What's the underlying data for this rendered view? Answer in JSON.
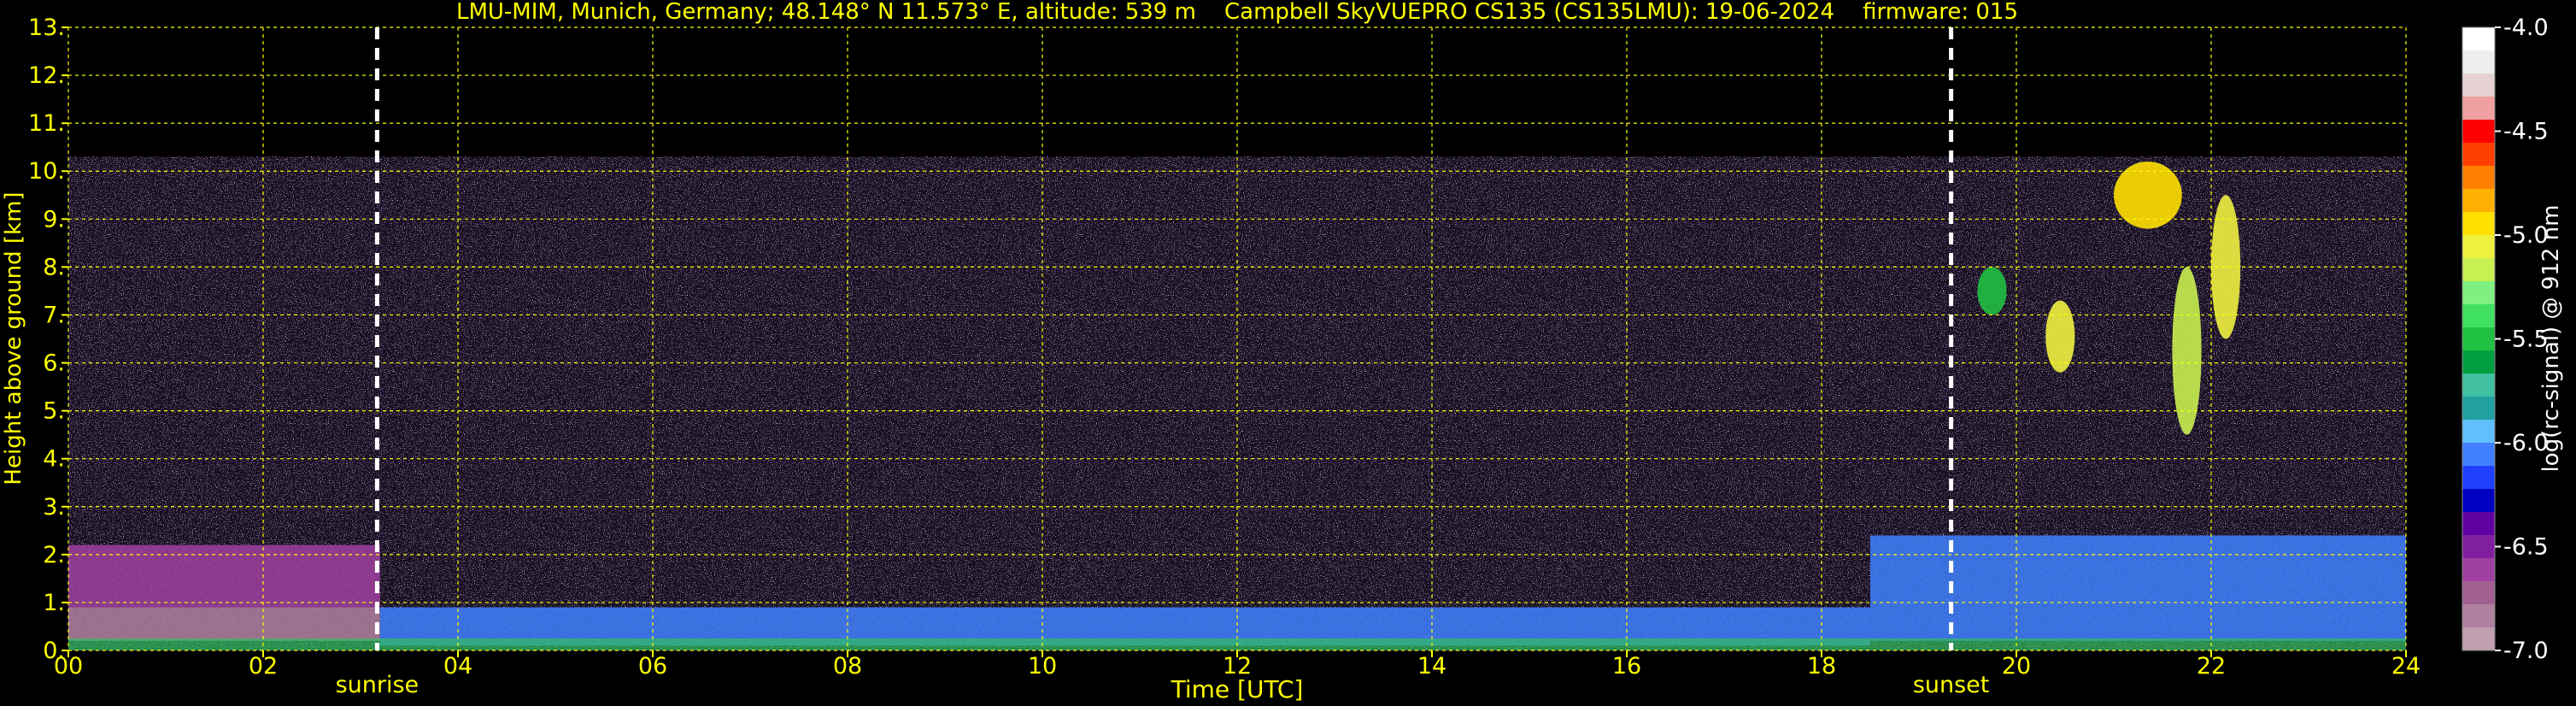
{
  "chart_data": {
    "type": "heatmap",
    "title": "LMU-MIM, Munich, Germany; 48.148° N 11.573° E, altitude: 539 m    Campbell SkyVUEPRO CS135 (CS135LMU): 19-06-2024    firmware: 015",
    "xlabel": "Time [UTC]",
    "ylabel": "Height above ground [km]",
    "xlim": [
      0,
      24
    ],
    "ylim": [
      0,
      13
    ],
    "xticks": [
      0,
      2,
      4,
      6,
      8,
      10,
      12,
      14,
      16,
      18,
      20,
      22,
      24
    ],
    "xtick_labels": [
      "00",
      "02",
      "04",
      "06",
      "08",
      "10",
      "12",
      "14",
      "16",
      "18",
      "20",
      "22",
      "24"
    ],
    "yticks": [
      0,
      1,
      2,
      3,
      4,
      5,
      6,
      7,
      8,
      9,
      10,
      11,
      12,
      13
    ],
    "ytick_labels": [
      "0.",
      "1.",
      "2.",
      "3.",
      "4.",
      "5.",
      "6.",
      "7.",
      "8.",
      "9.",
      "10.",
      "11.",
      "12.",
      "13."
    ],
    "grid": true,
    "colorbar": {
      "label": "log(rc-signal) @ 912 nm",
      "range": [
        -7.0,
        -4.0
      ],
      "ticks": [
        -4.0,
        -4.5,
        -5.0,
        -5.5,
        -6.0,
        -6.5,
        -7.0
      ],
      "tick_labels": [
        "-4.0",
        "-4.5",
        "-5.0",
        "-5.5",
        "-6.0",
        "-6.5",
        "-7.0"
      ],
      "colors": [
        "#ffffff",
        "#eeeeee",
        "#e6d2d2",
        "#f0a0a0",
        "#ff0000",
        "#ff4000",
        "#ff8000",
        "#ffb000",
        "#ffe000",
        "#f0f040",
        "#c8f050",
        "#80f080",
        "#40e060",
        "#20c040",
        "#00a040",
        "#40c0a0",
        "#20a0a0",
        "#60c0ff",
        "#4080ff",
        "#2040ff",
        "#0000c0",
        "#6000a0",
        "#8020a0",
        "#a040a0",
        "#a06090",
        "#b080a0",
        "#c0a0b0"
      ]
    },
    "markers": [
      {
        "label": "sunrise",
        "x": 3.17
      },
      {
        "label": "sunset",
        "x": 19.33
      }
    ],
    "data_top_km": 10.3,
    "features": [
      {
        "name": "noise-layer",
        "x": [
          0,
          24
        ],
        "y": [
          0,
          10.3
        ],
        "value": -6.5
      },
      {
        "name": "residual-layer",
        "x": [
          0,
          3.2
        ],
        "y": [
          0.9,
          2.2
        ],
        "value": -6.6
      },
      {
        "name": "boundary-layer-night",
        "x": [
          0,
          3.2
        ],
        "y": [
          0.2,
          0.9
        ],
        "value": -6.8
      },
      {
        "name": "boundary-layer-day",
        "x": [
          3.2,
          18.5
        ],
        "y": [
          0.1,
          0.9
        ],
        "value": -6.0
      },
      {
        "name": "evening-layer",
        "x": [
          18.5,
          24
        ],
        "y": [
          0.2,
          2.4
        ],
        "value": -6.0
      },
      {
        "name": "cloud-1",
        "x": [
          19.6,
          19.9
        ],
        "y": [
          7.0,
          8.0
        ],
        "value": -5.5
      },
      {
        "name": "cloud-2",
        "x": [
          20.3,
          20.6
        ],
        "y": [
          5.8,
          7.3
        ],
        "value": -5.1
      },
      {
        "name": "cloud-3",
        "x": [
          21.0,
          21.7
        ],
        "y": [
          8.8,
          10.2
        ],
        "value": -4.9
      },
      {
        "name": "cloud-4",
        "x": [
          21.6,
          21.9
        ],
        "y": [
          4.5,
          8.0
        ],
        "value": -5.2
      },
      {
        "name": "cloud-5",
        "x": [
          22.0,
          22.3
        ],
        "y": [
          6.5,
          9.5
        ],
        "value": -5.0
      }
    ]
  }
}
